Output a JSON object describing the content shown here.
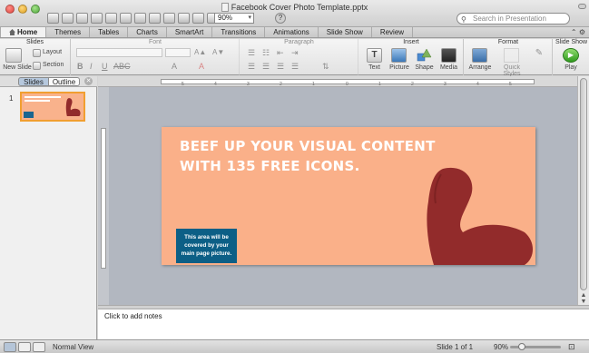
{
  "window": {
    "title": "Facebook Cover Photo Template.pptx"
  },
  "toolbar": {
    "zoom": "90%",
    "search_placeholder": "Search in Presentation",
    "help_glyph": "?"
  },
  "tabs": [
    {
      "label": "Home"
    },
    {
      "label": "Themes"
    },
    {
      "label": "Tables"
    },
    {
      "label": "Charts"
    },
    {
      "label": "SmartArt"
    },
    {
      "label": "Transitions"
    },
    {
      "label": "Animations"
    },
    {
      "label": "Slide Show"
    },
    {
      "label": "Review"
    }
  ],
  "ribbon": {
    "groups": {
      "slides": "Slides",
      "font": "Font",
      "paragraph": "Paragraph",
      "insert": "Insert",
      "format": "Format",
      "slide_show": "Slide Show"
    },
    "buttons": {
      "new_slide": "New Slide",
      "layout": "Layout",
      "section": "Section",
      "text": "Text",
      "picture": "Picture",
      "shape": "Shape",
      "media": "Media",
      "arrange": "Arrange",
      "quick_styles": "Quick Styles",
      "play": "Play"
    }
  },
  "left_pane": {
    "tab_slides": "Slides",
    "tab_outline": "Outline",
    "thumbnail_number": "1"
  },
  "slide": {
    "title_line1": "BEEF UP YOUR VISUAL CONTENT",
    "title_line2": "WITH 135 FREE ICONS.",
    "box_text_1": "This area will be",
    "box_text_2": "covered by your",
    "box_text_3": "main page picture.",
    "background_color": "#fab089",
    "box_color": "#0c5f86",
    "arm_color": "#922b2b"
  },
  "notes": {
    "placeholder": "Click to add notes"
  },
  "status_bar": {
    "view_label": "Normal View",
    "slide_counter": "Slide 1 of 1",
    "zoom": "90%"
  },
  "icons": [
    "close-icon",
    "minimize-icon",
    "maximize-icon",
    "home-icon",
    "search-icon",
    "help-icon",
    "gear-icon",
    "play-icon"
  ]
}
